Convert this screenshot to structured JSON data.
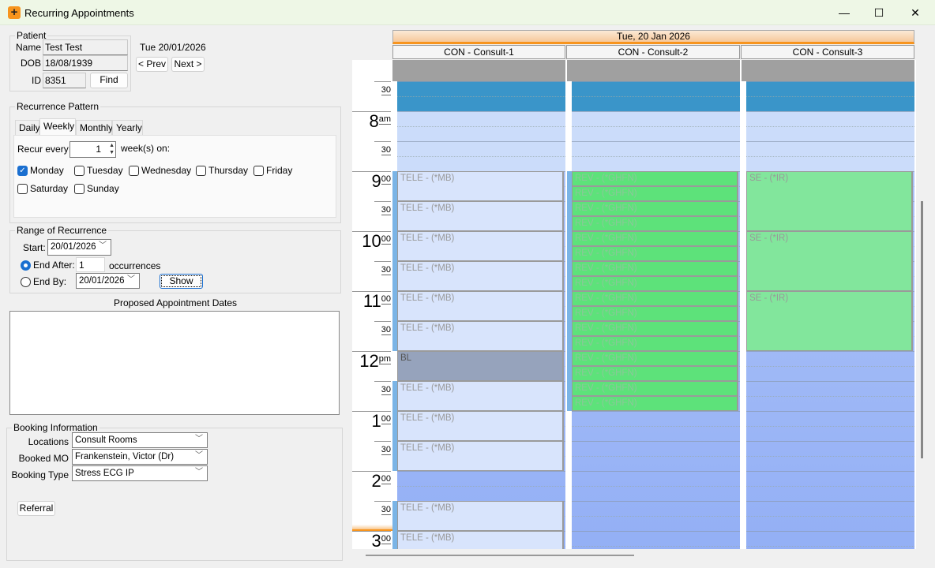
{
  "window": {
    "title": "Recurring Appointments",
    "minimize": "—",
    "maximize": "☐",
    "close": "✕"
  },
  "patient": {
    "legend": "Patient",
    "name_label": "Name",
    "name": "Test Test",
    "dob_label": "DOB",
    "dob": "18/08/1939",
    "id_label": "ID",
    "id": "8351",
    "find": "Find",
    "date": "Tue 20/01/2026",
    "prev": "< Prev",
    "next": "Next >"
  },
  "pattern": {
    "legend": "Recurrence Pattern",
    "tabs": [
      "Daily",
      "Weekly",
      "Monthly",
      "Yearly"
    ],
    "active_tab": "Weekly",
    "recur_label": "Recur every",
    "recur_value": "1",
    "recur_suffix": "week(s) on:",
    "days": [
      {
        "label": "Monday",
        "checked": true
      },
      {
        "label": "Tuesday",
        "checked": false
      },
      {
        "label": "Wednesday",
        "checked": false
      },
      {
        "label": "Thursday",
        "checked": false
      },
      {
        "label": "Friday",
        "checked": false
      },
      {
        "label": "Saturday",
        "checked": false
      },
      {
        "label": "Sunday",
        "checked": false
      }
    ]
  },
  "range": {
    "legend": "Range of Recurrence",
    "start_label": "Start:",
    "start": "20/01/2026",
    "end_after_label": "End After:",
    "end_after": "1",
    "occurrences": "occurrences",
    "end_by_label": "End By:",
    "end_by": "20/01/2026",
    "show": "Show",
    "selected": "End After"
  },
  "proposed": {
    "title": "Proposed Appointment Dates"
  },
  "booking": {
    "legend": "Booking Information",
    "locations_label": "Locations",
    "locations": "Consult Rooms",
    "mo_label": "Booked MO",
    "mo": "Frankenstein, Victor (Dr)",
    "type_label": "Booking Type",
    "type": "Stress ECG IP",
    "referral": "Referral"
  },
  "calendar": {
    "date": "Tue, 20 Jan 2026",
    "columns": [
      "CON - Consult-1",
      "CON - Consult-2",
      "CON - Consult-3"
    ],
    "time_labels": [
      {
        "t": "7:30",
        "h": "",
        "s": "30"
      },
      {
        "t": "8:00",
        "h": "8",
        "s": "am"
      },
      {
        "t": "8:30",
        "h": "",
        "s": "30"
      },
      {
        "t": "9:00",
        "h": "9",
        "s": "00"
      },
      {
        "t": "9:30",
        "h": "",
        "s": "30"
      },
      {
        "t": "10:00",
        "h": "10",
        "s": "00"
      },
      {
        "t": "10:30",
        "h": "",
        "s": "30"
      },
      {
        "t": "11:00",
        "h": "11",
        "s": "00"
      },
      {
        "t": "11:30",
        "h": "",
        "s": "30"
      },
      {
        "t": "12:00",
        "h": "12",
        "s": "pm"
      },
      {
        "t": "12:30",
        "h": "",
        "s": "30"
      },
      {
        "t": "13:00",
        "h": "1",
        "s": "00"
      },
      {
        "t": "13:30",
        "h": "",
        "s": "30"
      },
      {
        "t": "14:00",
        "h": "2",
        "s": "00"
      },
      {
        "t": "14:30",
        "h": "",
        "s": "30"
      },
      {
        "t": "15:00",
        "h": "3",
        "s": "00"
      }
    ],
    "colors": {
      "early": "#3a95c9",
      "morning": "#cbdcfa",
      "afternoon": "#a4bdf7",
      "tele": "#d8e4fc",
      "block": "#96a3bc",
      "rev": "#5de27a",
      "se": "#82e69c",
      "accent": "#f7941d"
    },
    "appointments": [
      {
        "col": 0,
        "start": "9:00",
        "end": "9:30",
        "label": "TELE - (*MB)",
        "kind": "tele"
      },
      {
        "col": 0,
        "start": "9:30",
        "end": "10:00",
        "label": "TELE - (*MB)",
        "kind": "tele"
      },
      {
        "col": 0,
        "start": "10:00",
        "end": "10:30",
        "label": "TELE - (*MB)",
        "kind": "tele"
      },
      {
        "col": 0,
        "start": "10:30",
        "end": "11:00",
        "label": "TELE - (*MB)",
        "kind": "tele"
      },
      {
        "col": 0,
        "start": "11:00",
        "end": "11:30",
        "label": "TELE - (*MB)",
        "kind": "tele"
      },
      {
        "col": 0,
        "start": "11:30",
        "end": "12:00",
        "label": "TELE - (*MB)",
        "kind": "tele"
      },
      {
        "col": 0,
        "start": "12:00",
        "end": "12:30",
        "label": "BL",
        "kind": "block"
      },
      {
        "col": 0,
        "start": "12:30",
        "end": "13:00",
        "label": "TELE - (*MB)",
        "kind": "tele"
      },
      {
        "col": 0,
        "start": "13:00",
        "end": "13:30",
        "label": "TELE - (*MB)",
        "kind": "tele"
      },
      {
        "col": 0,
        "start": "13:30",
        "end": "14:00",
        "label": "TELE - (*MB)",
        "kind": "tele"
      },
      {
        "col": 0,
        "start": "14:30",
        "end": "15:00",
        "label": "TELE - (*MB)",
        "kind": "tele"
      },
      {
        "col": 0,
        "start": "15:00",
        "end": "15:30",
        "label": "TELE - (*MB)",
        "kind": "tele"
      },
      {
        "col": 1,
        "start": "9:00",
        "end": "9:15",
        "label": "REV - (*GHFN)",
        "kind": "rev"
      },
      {
        "col": 1,
        "start": "9:15",
        "end": "9:30",
        "label": "REV - (*GHFN)",
        "kind": "rev"
      },
      {
        "col": 1,
        "start": "9:30",
        "end": "9:45",
        "label": "REV - (*GHFN)",
        "kind": "rev"
      },
      {
        "col": 1,
        "start": "9:45",
        "end": "10:00",
        "label": "REV - (*GHFN)",
        "kind": "rev"
      },
      {
        "col": 1,
        "start": "10:00",
        "end": "10:15",
        "label": "REV - (*GHFN)",
        "kind": "rev"
      },
      {
        "col": 1,
        "start": "10:15",
        "end": "10:30",
        "label": "REV - (*GHFN)",
        "kind": "rev"
      },
      {
        "col": 1,
        "start": "10:30",
        "end": "10:45",
        "label": "REV - (*GHFN)",
        "kind": "rev"
      },
      {
        "col": 1,
        "start": "10:45",
        "end": "11:00",
        "label": "REV - (*GHFN)",
        "kind": "rev"
      },
      {
        "col": 1,
        "start": "11:00",
        "end": "11:15",
        "label": "REV - (*GHFN)",
        "kind": "rev"
      },
      {
        "col": 1,
        "start": "11:15",
        "end": "11:30",
        "label": "REV - (*GHFN)",
        "kind": "rev"
      },
      {
        "col": 1,
        "start": "11:30",
        "end": "11:45",
        "label": "REV - (*GHFN)",
        "kind": "rev"
      },
      {
        "col": 1,
        "start": "11:45",
        "end": "12:00",
        "label": "REV - (*GHFN)",
        "kind": "rev"
      },
      {
        "col": 1,
        "start": "12:00",
        "end": "12:15",
        "label": "REV - (*GHFN)",
        "kind": "rev"
      },
      {
        "col": 1,
        "start": "12:15",
        "end": "12:30",
        "label": "REV - (*GHFN)",
        "kind": "rev"
      },
      {
        "col": 1,
        "start": "12:30",
        "end": "12:45",
        "label": "REV - (*GHFN)",
        "kind": "rev"
      },
      {
        "col": 1,
        "start": "12:45",
        "end": "13:00",
        "label": "REV - (*GHFN)",
        "kind": "rev"
      },
      {
        "col": 2,
        "start": "9:00",
        "end": "10:00",
        "label": "SE - (*IR)",
        "kind": "se"
      },
      {
        "col": 2,
        "start": "10:00",
        "end": "11:00",
        "label": "SE - (*IR)",
        "kind": "se"
      },
      {
        "col": 2,
        "start": "11:00",
        "end": "12:00",
        "label": "SE - (*IR)",
        "kind": "se"
      }
    ]
  }
}
